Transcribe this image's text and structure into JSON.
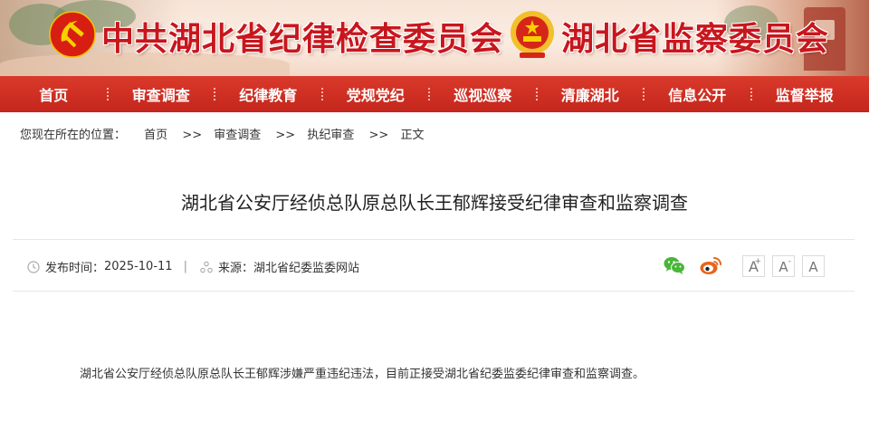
{
  "header": {
    "title_left": "中共湖北省纪律检查委员会",
    "title_right": "湖北省监察委员会",
    "left_emblem": "party-emblem-icon",
    "right_emblem": "national-emblem-icon"
  },
  "nav": {
    "items": [
      {
        "label": "首页"
      },
      {
        "label": "审查调查"
      },
      {
        "label": "纪律教育"
      },
      {
        "label": "党规党纪"
      },
      {
        "label": "巡视巡察"
      },
      {
        "label": "清廉湖北"
      },
      {
        "label": "信息公开"
      },
      {
        "label": "监督举报"
      }
    ]
  },
  "breadcrumb": {
    "prefix": "您现在所在的位置：",
    "items": [
      "首页",
      "审查调查",
      "执纪审查",
      "正文"
    ],
    "separator": ">>"
  },
  "article": {
    "title": "湖北省公安厅经侦总队原总队长王郁辉接受纪律审查和监察调查",
    "publish_label": "发布时间：",
    "publish_date": "2025-10-11",
    "divider": "|",
    "source_label": "来源：",
    "source_value": "湖北省纪委监委网站",
    "body": "湖北省公安厅经侦总队原总队长王郁辉涉嫌严重违纪违法，目前正接受湖北省纪委监委纪律审查和监察调查。"
  },
  "share": {
    "icons": [
      "wechat-icon",
      "weibo-icon"
    ]
  },
  "font_size": {
    "large": "A",
    "medium": "A",
    "small": "A"
  },
  "colors": {
    "brand_red": "#c8161d",
    "nav_red": "#d0301f",
    "wechat_green": "#48b637",
    "weibo_orange": "#e8641b"
  }
}
